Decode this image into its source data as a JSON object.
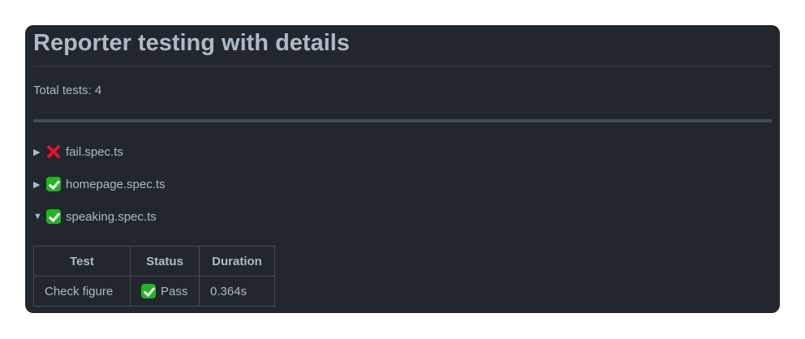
{
  "title": "Reporter testing with details",
  "total_tests": "Total tests: 4",
  "files": [
    {
      "name": "fail.spec.ts",
      "status": "fail",
      "icon": "cross-mark-icon",
      "expanded": false
    },
    {
      "name": "homepage.spec.ts",
      "status": "pass",
      "icon": "check-mark-icon",
      "expanded": false
    },
    {
      "name": "speaking.spec.ts",
      "status": "pass",
      "icon": "check-mark-icon",
      "expanded": true
    }
  ],
  "table": {
    "headers": [
      "Test",
      "Status",
      "Duration"
    ],
    "rows": [
      {
        "test": "Check figure",
        "status": "Pass",
        "duration": "0.364s"
      }
    ]
  },
  "colors": {
    "background": "#22272e",
    "text": "#adbac7",
    "pass": "#22b523",
    "fail": "#e8112d"
  }
}
